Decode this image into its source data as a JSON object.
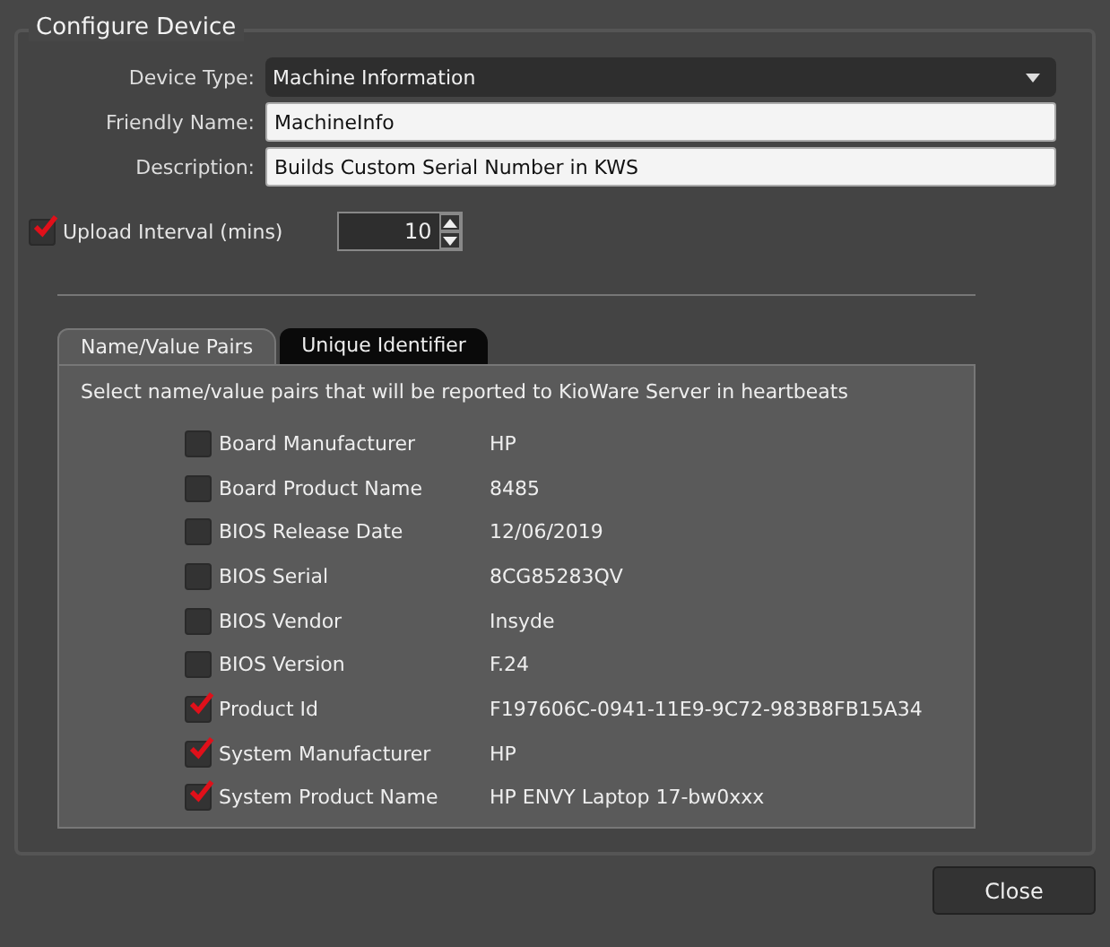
{
  "group_title": "Configure Device",
  "device_type": {
    "label": "Device Type:",
    "value": "Machine Information"
  },
  "friendly_name": {
    "label": "Friendly Name:",
    "value": "MachineInfo"
  },
  "description": {
    "label": "Description:",
    "value": "Builds Custom Serial Number in KWS"
  },
  "upload_interval": {
    "label": "Upload Interval (mins)",
    "checked": true,
    "value": "10"
  },
  "tabs": [
    {
      "label": "Name/Value Pairs",
      "selected": true
    },
    {
      "label": "Unique Identifier",
      "selected": false
    }
  ],
  "instruction": "Select name/value pairs that will be reported to KioWare Server in heartbeats",
  "pairs": [
    {
      "name": "Board Manufacturer",
      "value": "HP",
      "checked": false
    },
    {
      "name": "Board Product Name",
      "value": "8485",
      "checked": false
    },
    {
      "name": "BIOS Release Date",
      "value": "12/06/2019",
      "checked": false
    },
    {
      "name": "BIOS Serial",
      "value": "8CG85283QV",
      "checked": false
    },
    {
      "name": "BIOS Vendor",
      "value": "Insyde",
      "checked": false
    },
    {
      "name": "BIOS Version",
      "value": "F.24",
      "checked": false
    },
    {
      "name": "Product Id",
      "value": "F197606C-0941-11E9-9C72-983B8FB15A34",
      "checked": true
    },
    {
      "name": "System Manufacturer",
      "value": "HP",
      "checked": true
    },
    {
      "name": "System Product Name",
      "value": "HP ENVY Laptop 17-bw0xxx",
      "checked": true
    }
  ],
  "close_button": "Close"
}
